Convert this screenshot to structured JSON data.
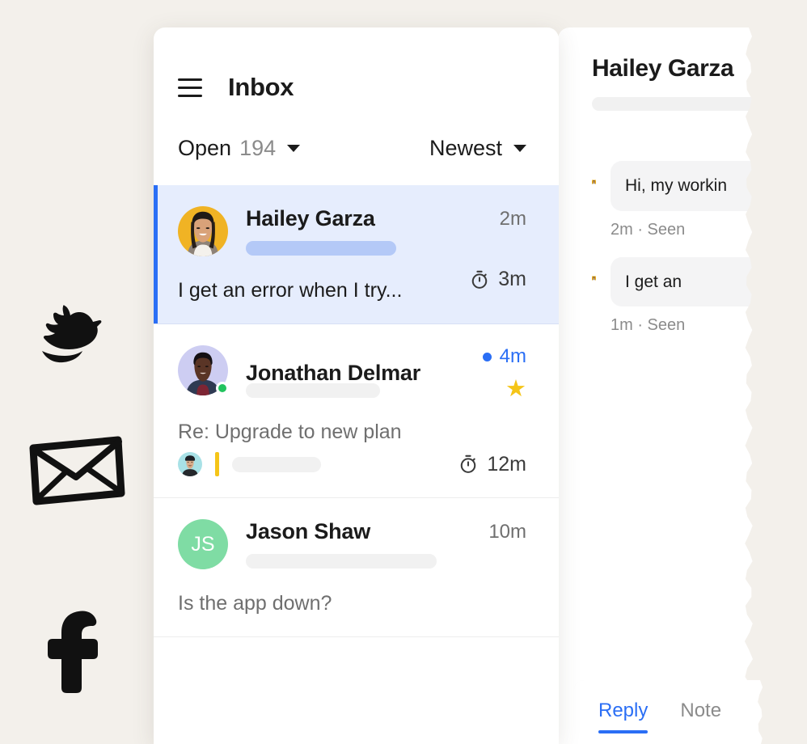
{
  "theme": {
    "background": "#f3f0eb",
    "panel": "#ffffff",
    "accent_blue": "#2a6ef5",
    "selected_row": "#e6edfd",
    "star_gold": "#f5c518",
    "online_green": "#22c35e",
    "muted_text": "#6f6f6f",
    "bubble": "#f4f4f5"
  },
  "decorations": [
    {
      "name": "bird-doodle-icon",
      "label": "bird"
    },
    {
      "name": "envelope-doodle-icon",
      "label": "envelope"
    },
    {
      "name": "facebook-doodle-icon",
      "label": "facebook f"
    }
  ],
  "inbox": {
    "menu_icon": "hamburger-icon",
    "title": "Inbox",
    "filters": {
      "status": {
        "label": "Open",
        "count": "194",
        "caret": "chevron-down-icon"
      },
      "sort": {
        "label": "Newest",
        "caret": "chevron-down-icon"
      }
    },
    "conversations": [
      {
        "name": "Hailey Garza",
        "time": "2m",
        "selected": true,
        "unread": false,
        "starred": false,
        "online": false,
        "avatar_kind": "photo-amber",
        "avatar_initials": "",
        "preview": "I get an error when I try...",
        "preview_dark": true,
        "subject": "",
        "skeleton_blue": true,
        "sla_icon": "stopwatch-icon",
        "sla_time": "3m",
        "has_footer_row": false
      },
      {
        "name": "Jonathan Delmar",
        "time": "4m",
        "selected": false,
        "unread": true,
        "starred": true,
        "online": true,
        "avatar_kind": "photo-lavender",
        "avatar_initials": "",
        "preview": "Re: Upgrade to new plan",
        "preview_dark": false,
        "subject": "",
        "skeleton_blue": false,
        "sla_icon": "stopwatch-icon",
        "sla_time": "12m",
        "has_footer_row": true
      },
      {
        "name": "Jason Shaw",
        "time": "10m",
        "selected": false,
        "unread": false,
        "starred": false,
        "online": false,
        "avatar_kind": "initials-green",
        "avatar_initials": "JS",
        "preview": "Is the app down?",
        "preview_dark": false,
        "subject": "",
        "skeleton_blue": false,
        "sla_icon": "",
        "sla_time": "",
        "has_footer_row": false
      }
    ]
  },
  "detail": {
    "title": "Hailey Garza",
    "messages": [
      {
        "text": "Hi, my  workin",
        "meta": "2m · Seen",
        "two_line": true
      },
      {
        "text": "I get an",
        "meta": "1m · Seen",
        "two_line": false
      }
    ]
  },
  "composer": {
    "tabs": [
      {
        "label": "Reply",
        "active": true
      },
      {
        "label": "Note",
        "active": false
      }
    ]
  }
}
